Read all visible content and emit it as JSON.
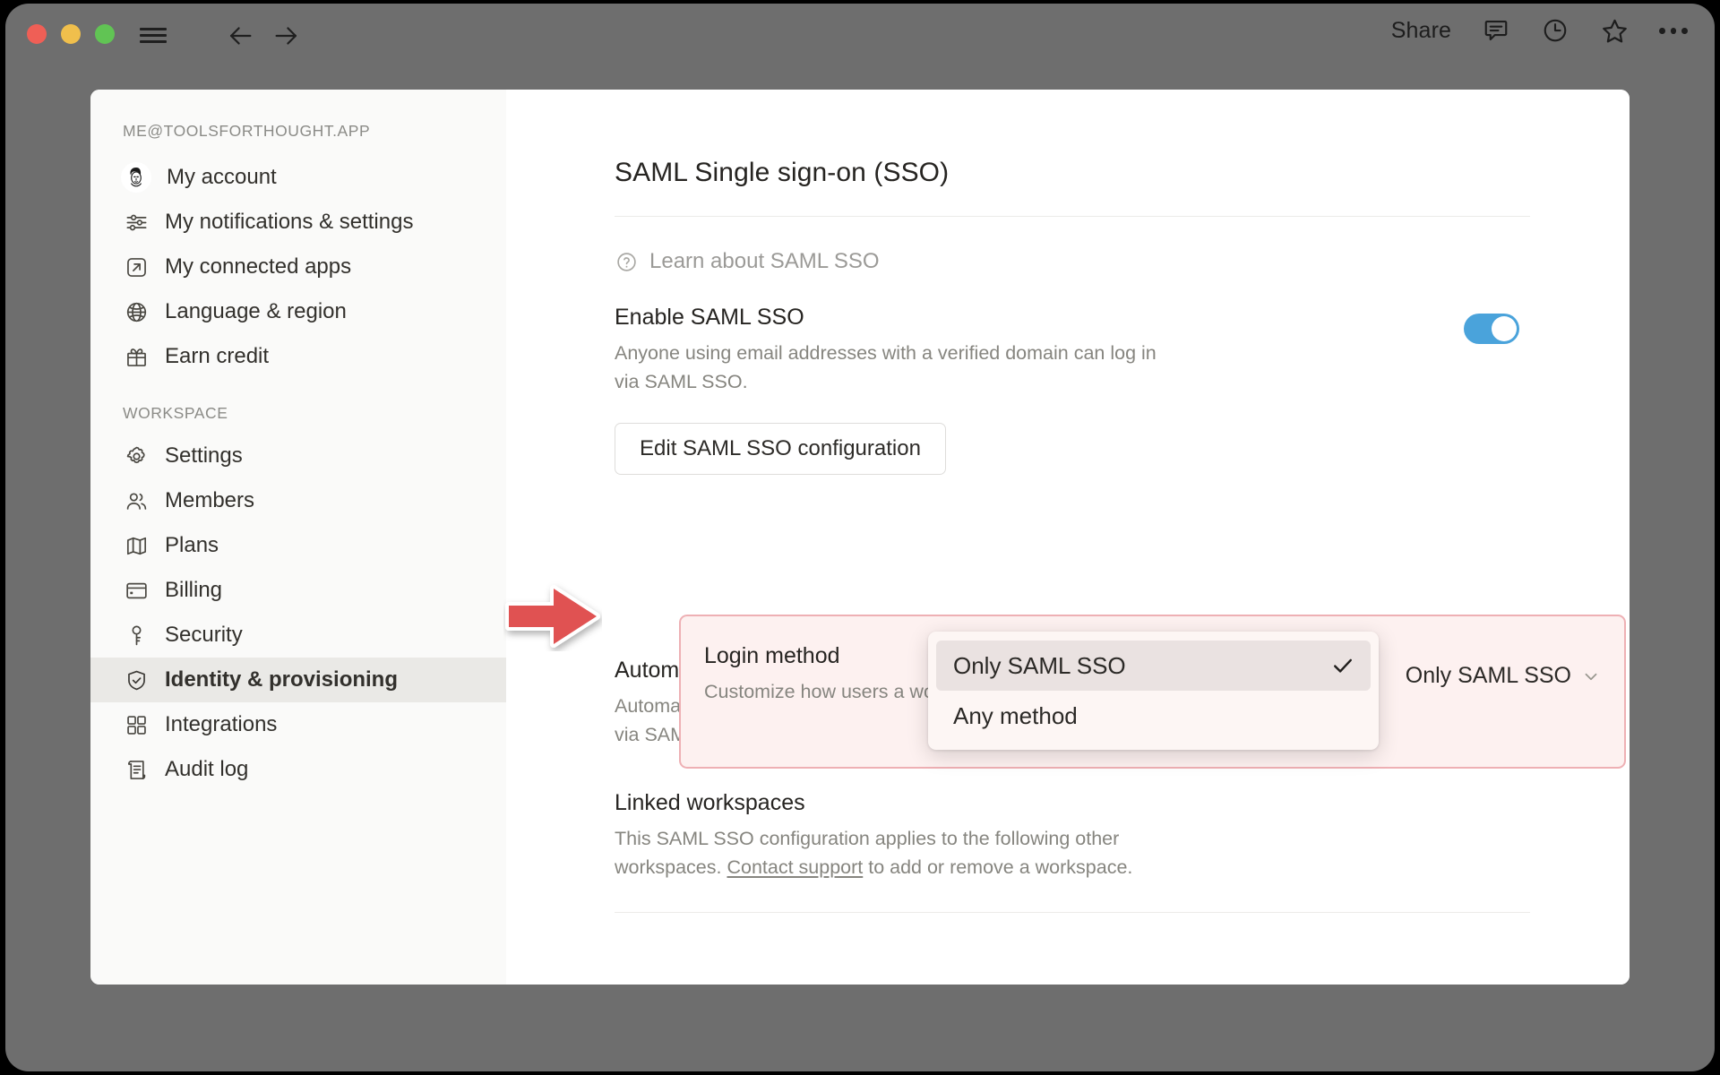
{
  "titlebar": {
    "share_label": "Share",
    "icons": [
      "hamburger-icon",
      "back-arrow-icon",
      "forward-arrow-icon",
      "comment-icon",
      "history-clock-icon",
      "star-icon",
      "more-options-icon"
    ]
  },
  "sidebar": {
    "account_header": "ME@TOOLSFORTHOUGHT.APP",
    "account_items": [
      {
        "label": "My account",
        "icon": "avatar"
      },
      {
        "label": "My notifications & settings",
        "icon": "sliders-icon"
      },
      {
        "label": "My connected apps",
        "icon": "external-link-icon"
      },
      {
        "label": "Language & region",
        "icon": "globe-icon"
      },
      {
        "label": "Earn credit",
        "icon": "gift-icon"
      }
    ],
    "workspace_header": "WORKSPACE",
    "workspace_items": [
      {
        "label": "Settings",
        "icon": "gear-icon",
        "active": false
      },
      {
        "label": "Members",
        "icon": "people-icon",
        "active": false
      },
      {
        "label": "Plans",
        "icon": "map-icon",
        "active": false
      },
      {
        "label": "Billing",
        "icon": "credit-card-icon",
        "active": false
      },
      {
        "label": "Security",
        "icon": "key-icon",
        "active": false
      },
      {
        "label": "Identity & provisioning",
        "icon": "shield-check-icon",
        "active": true
      },
      {
        "label": "Integrations",
        "icon": "grid-icon",
        "active": false
      },
      {
        "label": "Audit log",
        "icon": "scroll-icon",
        "active": false
      }
    ]
  },
  "main": {
    "page_title": "SAML Single sign-on (SSO)",
    "learn_link": "Learn about SAML SSO",
    "enable_sso": {
      "title": "Enable SAML SSO",
      "description": "Anyone using email addresses with a verified domain can log in via SAML SSO.",
      "toggle_state": "on",
      "button_label": "Edit SAML SSO configuration"
    },
    "login_method": {
      "title": "Login method",
      "description": "Customize how users a workspaces.",
      "selected_value": "Only SAML SSO",
      "options": [
        {
          "label": "Only SAML SSO",
          "selected": true
        },
        {
          "label": "Any method",
          "selected": false
        }
      ]
    },
    "auto_account": {
      "title": "Automatic account creation",
      "description": "Automatically create Notion accounts for new users who log in via SAML SSO.",
      "toggle_state": "on"
    },
    "linked_workspaces": {
      "title": "Linked workspaces",
      "description_part1": "This SAML SSO configuration applies to the following other workspaces. ",
      "link_text": "Contact support",
      "description_part2": " to add or remove a workspace."
    }
  },
  "annotation": {
    "type": "red-arrow",
    "points_at": "login-method-row",
    "color": "#e05252"
  },
  "colors": {
    "accent_toggle": "#4aa3db",
    "highlight_border": "#eeb0b4",
    "highlight_fill": "#fdf1f0",
    "sidebar_bg": "#fafaf9",
    "window_chrome": "#6e6e6e"
  }
}
